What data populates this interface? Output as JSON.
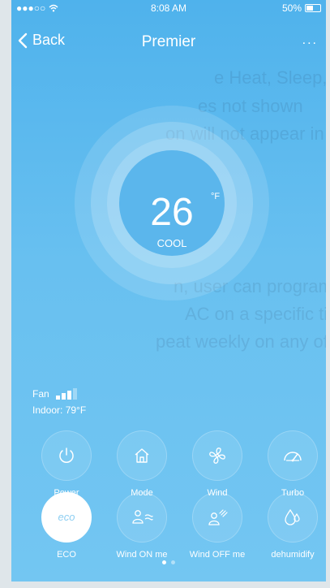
{
  "status_bar": {
    "signal": "●●●○○",
    "time": "8:08 AM",
    "battery_text": "50%",
    "battery_level": 0.5
  },
  "nav": {
    "back_label": "Back",
    "title": "Premier",
    "more_label": "..."
  },
  "thermostat": {
    "temperature": "26",
    "unit": "°F",
    "mode": "COOL"
  },
  "fan": {
    "label": "Fan",
    "level": 3,
    "max_level": 4
  },
  "indoor": "Indoor: 79°F",
  "controls": [
    {
      "label": "Power",
      "icon": "power-icon",
      "active": false
    },
    {
      "label": "Mode",
      "icon": "house-icon",
      "active": false
    },
    {
      "label": "Wind",
      "icon": "fan-blades-icon",
      "active": false
    },
    {
      "label": "Turbo",
      "icon": "gauge-icon",
      "active": false
    },
    {
      "label": "ECO",
      "icon": "eco-icon",
      "active": true
    },
    {
      "label": "Wind ON me",
      "icon": "wind-on-person-icon",
      "active": false
    },
    {
      "label": "Wind OFF me",
      "icon": "wind-off-person-icon",
      "active": false
    },
    {
      "label": "dehumidify",
      "icon": "droplet-icon",
      "active": false
    }
  ],
  "pager": {
    "pages": 2,
    "current": 1
  },
  "colors": {
    "background": "#5bb6ec",
    "text": "#ffffff",
    "eco_icon": "#8fcff2"
  }
}
